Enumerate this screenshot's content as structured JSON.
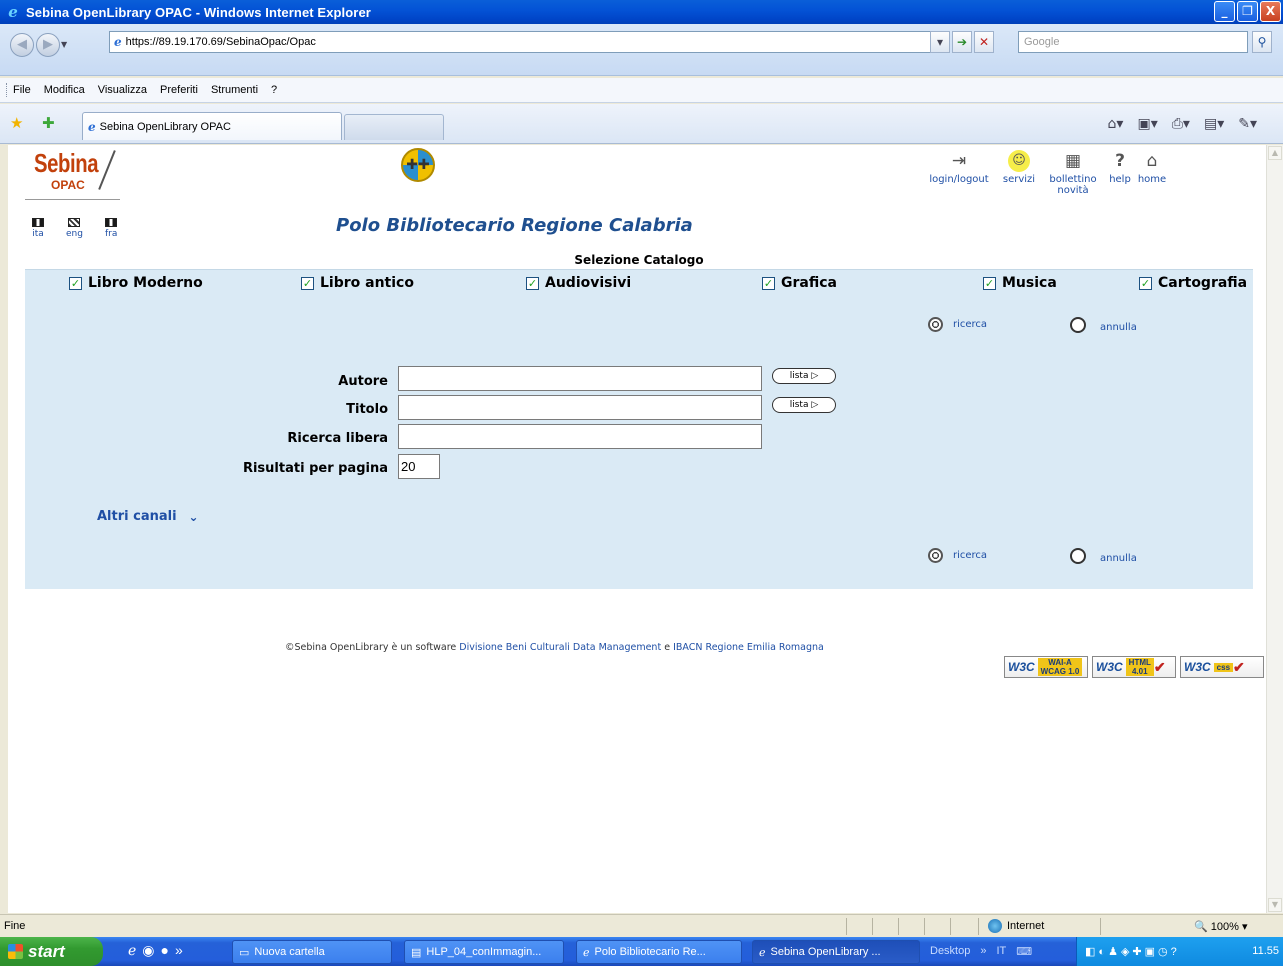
{
  "window": {
    "title": "Sebina OpenLibrary OPAC - Windows Internet Explorer",
    "minimize": "_",
    "maximize": "❐",
    "close": "X"
  },
  "address": {
    "url": "https://89.19.170.69/SebinaOpac/Opac",
    "search_placeholder": "Google"
  },
  "menu": [
    "File",
    "Modifica",
    "Visualizza",
    "Preferiti",
    "Strumenti",
    "?"
  ],
  "tabs": {
    "active_label": "Sebina OpenLibrary OPAC"
  },
  "page": {
    "logo_line1": "Sebina",
    "logo_line2": "OPAC",
    "banner_title": "Polo Bibliotecario Regione Calabria",
    "languages": [
      {
        "code": "ita"
      },
      {
        "code": "eng"
      },
      {
        "code": "fra"
      }
    ],
    "top_links": [
      {
        "label": "login/logout",
        "icon": "login-icon"
      },
      {
        "label": "servizi",
        "icon": "smile-icon"
      },
      {
        "label": "bollettino",
        "label2": "novità",
        "icon": "bulletin-icon"
      },
      {
        "label": "help",
        "icon": "help-icon"
      },
      {
        "label": "home",
        "icon": "home-icon"
      }
    ]
  },
  "search": {
    "catalog_heading": "Selezione Catalogo",
    "catalogs": [
      {
        "label": "Libro Moderno",
        "checked": true
      },
      {
        "label": "Libro antico",
        "checked": true
      },
      {
        "label": "Audiovisivi",
        "checked": true
      },
      {
        "label": "Grafica",
        "checked": true
      },
      {
        "label": "Musica",
        "checked": true
      },
      {
        "label": "Cartografia",
        "checked": true
      }
    ],
    "ricerca_label": "ricerca",
    "annulla_label": "annulla",
    "fields": {
      "autore_label": "Autore",
      "autore_value": "",
      "titolo_label": "Titolo",
      "titolo_value": "",
      "libera_label": "Ricerca libera",
      "libera_value": "",
      "risultati_label": "Risultati per pagina",
      "risultati_value": "20"
    },
    "lista_label": "lista",
    "altri_canali": "Altri canali"
  },
  "footer": {
    "prefix": "©Sebina OpenLibrary è un software",
    "link1": "Divisione Beni Culturali Data Management",
    "conj": "e",
    "link2": "IBACN Regione Emilia Romagna",
    "badge_w3c": "W3C",
    "badge_wai_1": "WAI-A",
    "badge_wai_2": "WCAG 1.0",
    "badge_html_1": "HTML",
    "badge_html_2": "4.01",
    "badge_css": "css"
  },
  "status": {
    "text": "Fine",
    "zone": "Internet",
    "zoom": "100%"
  },
  "taskbar": {
    "start": "start",
    "items": [
      {
        "label": "Nuova cartella"
      },
      {
        "label": "HLP_04_conImmagin..."
      },
      {
        "label": "Polo Bibliotecario Re..."
      },
      {
        "label": "Sebina OpenLibrary ..."
      }
    ],
    "desktop": "Desktop",
    "lang": "IT",
    "clock": "11.55"
  }
}
